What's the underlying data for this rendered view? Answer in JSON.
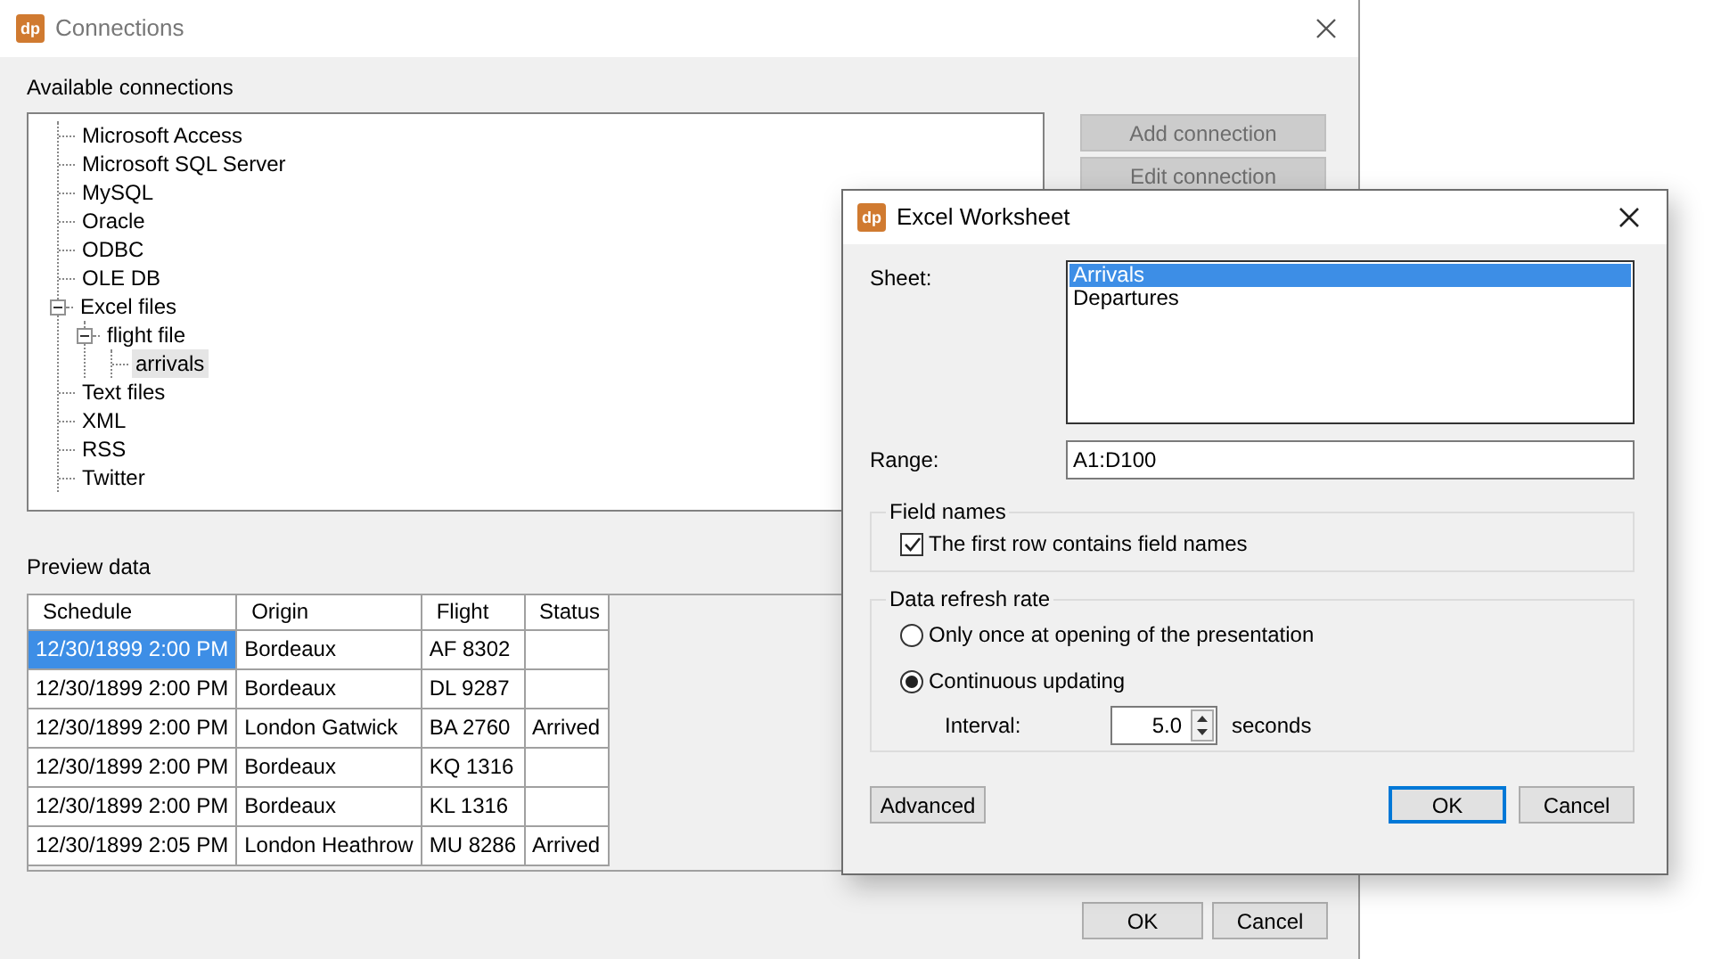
{
  "main_window": {
    "logo": "dp",
    "title": "Connections",
    "connections_label": "Available connections",
    "tree": [
      {
        "label": "Microsoft Access",
        "selected": false
      },
      {
        "label": "Microsoft SQL Server",
        "selected": false
      },
      {
        "label": "MySQL",
        "selected": false
      },
      {
        "label": "Oracle",
        "selected": false
      },
      {
        "label": "ODBC",
        "selected": false
      },
      {
        "label": "OLE DB",
        "selected": false
      },
      {
        "label": "Excel files",
        "selected": false,
        "expanded": true,
        "children": [
          {
            "label": "flight file",
            "selected": false,
            "expanded": true,
            "children": [
              {
                "label": "arrivals",
                "selected": true
              }
            ]
          }
        ]
      },
      {
        "label": "Text files",
        "selected": false
      },
      {
        "label": "XML",
        "selected": false
      },
      {
        "label": "RSS",
        "selected": false
      },
      {
        "label": "Twitter",
        "selected": false
      }
    ],
    "side_buttons": [
      {
        "label": "Add connection",
        "disabled": true
      },
      {
        "label": "Edit connection",
        "disabled": true
      }
    ],
    "preview_label": "Preview data",
    "preview_table": {
      "columns": [
        "Schedule",
        "Origin",
        "Flight",
        "Status"
      ],
      "rows": [
        {
          "schedule": "12/30/1899 2:00 PM",
          "origin": "Bordeaux",
          "flight": "AF 8302",
          "selected": true
        },
        {
          "schedule": "12/30/1899 2:00 PM",
          "origin": "Bordeaux",
          "flight": "DL 9287",
          "selected": false
        },
        {
          "schedule": "12/30/1899 2:00 PM",
          "origin": "London Gatwick",
          "flight": "BA 2760",
          "status": "Arrived",
          "selected": false
        },
        {
          "schedule": "12/30/1899 2:00 PM",
          "origin": "Bordeaux",
          "flight": "KQ 1316",
          "selected": false
        },
        {
          "schedule": "12/30/1899 2:00 PM",
          "origin": "Bordeaux",
          "flight": "KL 1316",
          "selected": false
        },
        {
          "schedule": "12/30/1899 2:05 PM",
          "origin": "London Heathrow",
          "flight": "MU 8286",
          "status": "Arrived",
          "selected": false
        }
      ]
    },
    "buttons": [
      {
        "label": "OK",
        "default": false
      },
      {
        "label": "Cancel",
        "default": false
      }
    ]
  },
  "dialog": {
    "logo": "dp",
    "title": "Excel Worksheet",
    "sheet_label": "Sheet:",
    "sheets": [
      {
        "label": "Arrivals",
        "selected": true
      },
      {
        "label": "Departures",
        "selected": false
      }
    ],
    "range_label": "Range:",
    "range_value": "A1:D100",
    "field_names": {
      "title": "Field names",
      "checkbox": {
        "label": "The first row contains field names",
        "checked": true
      }
    },
    "refresh": {
      "title": "Data refresh rate",
      "options": [
        {
          "label": "Only once at opening of the presentation",
          "selected": false
        },
        {
          "label": "Continuous updating",
          "selected": true
        }
      ],
      "interval_label": "Interval:",
      "interval_value": "5.0",
      "interval_unit": "seconds"
    },
    "advanced_button": "Advanced",
    "buttons": [
      {
        "label": "OK",
        "default": true
      },
      {
        "label": "Cancel",
        "default": false
      }
    ]
  }
}
